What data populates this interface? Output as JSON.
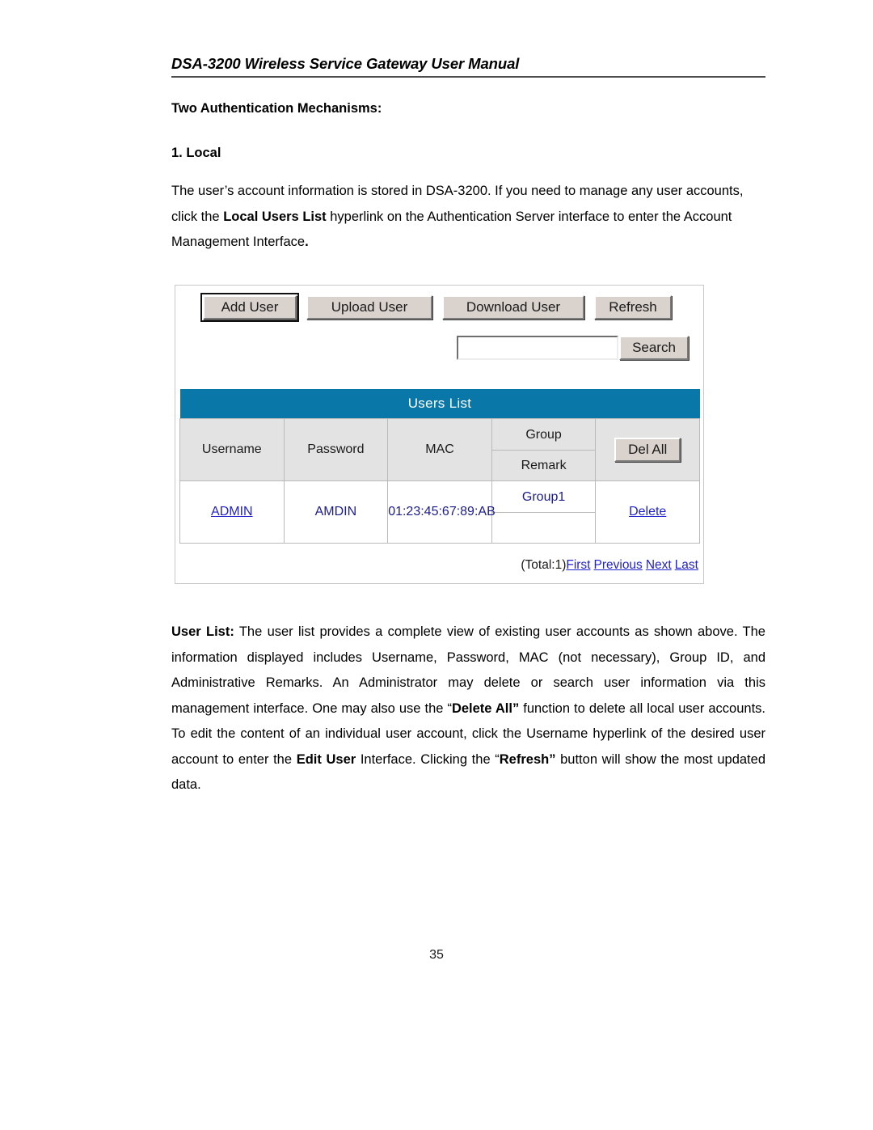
{
  "document": {
    "running_head": "DSA-3200 Wireless Service Gateway User Manual",
    "page_number": "35"
  },
  "content": {
    "heading": "Two Authentication Mechanisms:",
    "subheading": "1. Local",
    "paragraph1_part1": "The user’s account information is stored in DSA-3200. If you need to manage any user accounts, click the ",
    "paragraph1_bold1": "Local Users List",
    "paragraph1_part2": " hyperlink on the Authentication Server interface to enter the Account Management Interface",
    "paragraph1_part3": ".",
    "paragraph2_bold1": "User List:",
    "paragraph2_part1": " The user list provides a complete view of existing user accounts as shown above. The information displayed includes Username, Password, MAC (not necessary), Group ID, and Administrative Remarks. An Administrator may delete or search user information via this management interface. One may also use the “",
    "paragraph2_bold2": "Delete All”",
    "paragraph2_part2": " function to delete all local user accounts.   To edit the content of an individual user account, click the Username hyperlink of the desired user account to enter the ",
    "paragraph2_bold3": "Edit User",
    "paragraph2_part3": " Interface.   Clicking the “",
    "paragraph2_bold4": "Refresh”",
    "paragraph2_part4": " button will show the most updated data."
  },
  "figure": {
    "toolbar": {
      "add_user": "Add User",
      "upload_user": "Upload User",
      "download_user": "Download User",
      "refresh": "Refresh"
    },
    "search": {
      "value": "",
      "button_label": "Search"
    },
    "list_title": "Users List",
    "headers": {
      "username": "Username",
      "password": "Password",
      "mac": "MAC",
      "group": "Group",
      "remark": "Remark",
      "del_all": "Del All"
    },
    "rows": [
      {
        "username": "ADMIN",
        "password": "AMDIN",
        "mac": "01:23:45:67:89:AB",
        "group": "Group1",
        "remark": "",
        "action": "Delete"
      }
    ],
    "pagination": {
      "total": "(Total:1)",
      "first": "First",
      "previous": "Previous",
      "next": "Next",
      "last": "Last"
    },
    "colors": {
      "title_bar": "#0a77a9",
      "button_face": "#d9d2cd",
      "header_cell": "#e3e3e3",
      "link": "#2222cc",
      "data_text": "#1c1c8c"
    }
  }
}
